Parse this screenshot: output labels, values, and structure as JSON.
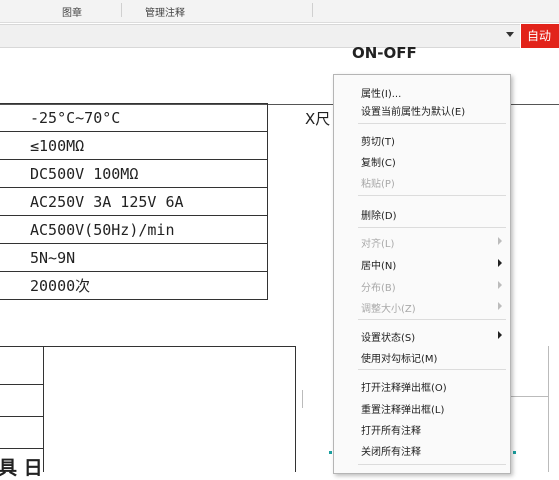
{
  "ribbon": {
    "tabs": [
      "图章",
      "管理注释"
    ]
  },
  "toolbar": {
    "auto_label": "自动"
  },
  "doc": {
    "on_off": "ON-OFF",
    "x_label": "X尺",
    "rows": [
      "-25°C~70°C",
      "≤100MΩ",
      "DC500V 100MΩ",
      "AC250V 3A 125V 6A",
      "AC500V(50Hz)/min",
      "5N~9N",
      "20000次"
    ],
    "bottom_text": "具 日"
  },
  "context_menu": {
    "items": [
      {
        "label": "属性(I)...",
        "enabled": true,
        "submenu": false
      },
      {
        "label": "设置当前属性为默认(E)",
        "enabled": true,
        "submenu": false
      },
      {
        "label": "剪切(T)",
        "enabled": true,
        "submenu": false
      },
      {
        "label": "复制(C)",
        "enabled": true,
        "submenu": false
      },
      {
        "label": "粘贴(P)",
        "enabled": false,
        "submenu": false
      },
      {
        "label": "删除(D)",
        "enabled": true,
        "submenu": false
      },
      {
        "label": "对齐(L)",
        "enabled": false,
        "submenu": true
      },
      {
        "label": "居中(N)",
        "enabled": true,
        "submenu": true
      },
      {
        "label": "分布(B)",
        "enabled": false,
        "submenu": true
      },
      {
        "label": "调整大小(Z)",
        "enabled": false,
        "submenu": true
      },
      {
        "label": "设置状态(S)",
        "enabled": true,
        "submenu": true
      },
      {
        "label": "使用对勾标记(M)",
        "enabled": true,
        "submenu": false
      },
      {
        "label": "打开注释弹出框(O)",
        "enabled": true,
        "submenu": false
      },
      {
        "label": "重置注释弹出框(L)",
        "enabled": true,
        "submenu": false
      },
      {
        "label": "打开所有注释",
        "enabled": true,
        "submenu": false
      },
      {
        "label": "关闭所有注释",
        "enabled": true,
        "submenu": false
      }
    ]
  },
  "colors": {
    "accent": "#e2231a",
    "menu_bg": "#fafafa",
    "disabled_text": "#a9a9a9"
  }
}
